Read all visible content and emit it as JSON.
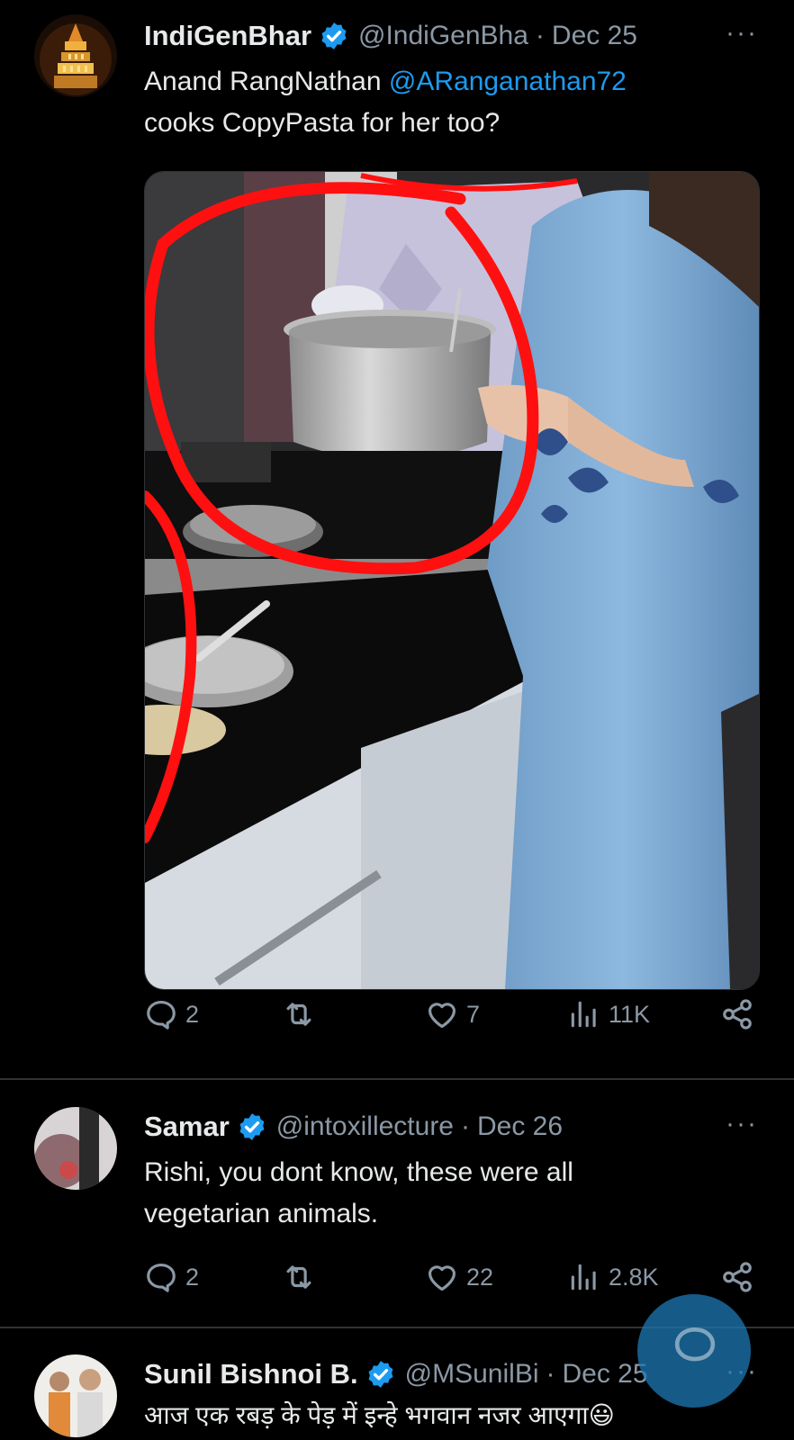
{
  "tweets": [
    {
      "name": "IndiGenBhar",
      "handle": "@IndiGenBha",
      "date": "Dec 25",
      "text_line1_before": "Anand RangNathan ",
      "mention": "@ARanganathan72",
      "text_line2": "cooks CopyPasta for her too?",
      "replies": "2",
      "likes": "7",
      "views": "11K"
    },
    {
      "name": "Samar",
      "handle": "@intoxillecture",
      "date": "Dec 26",
      "text_line1": "Rishi, you dont know, these were all",
      "text_line2": "vegetarian animals.",
      "replies": "2",
      "likes": "22",
      "views": "2.8K"
    },
    {
      "name": "Sunil Bishnoi B.",
      "handle": "@MSunilBi",
      "date": "Dec 25",
      "text_line1": "आज एक रबड़ के पेड़ में इन्हे भगवान नजर आएगा",
      "emoji": "😃"
    }
  ],
  "ui": {
    "more_label": "···",
    "separator": "·"
  },
  "colors": {
    "background": "#000000",
    "text": "#e7e9ea",
    "muted": "#8b98a5",
    "link": "#1d9bf0",
    "verified": "#1d9bf0",
    "divider": "#2f3336"
  },
  "icons": [
    "verified-badge-icon",
    "reply-icon",
    "retweet-icon",
    "like-icon",
    "views-icon",
    "share-icon",
    "more-icon",
    "compose-fab-icon"
  ]
}
